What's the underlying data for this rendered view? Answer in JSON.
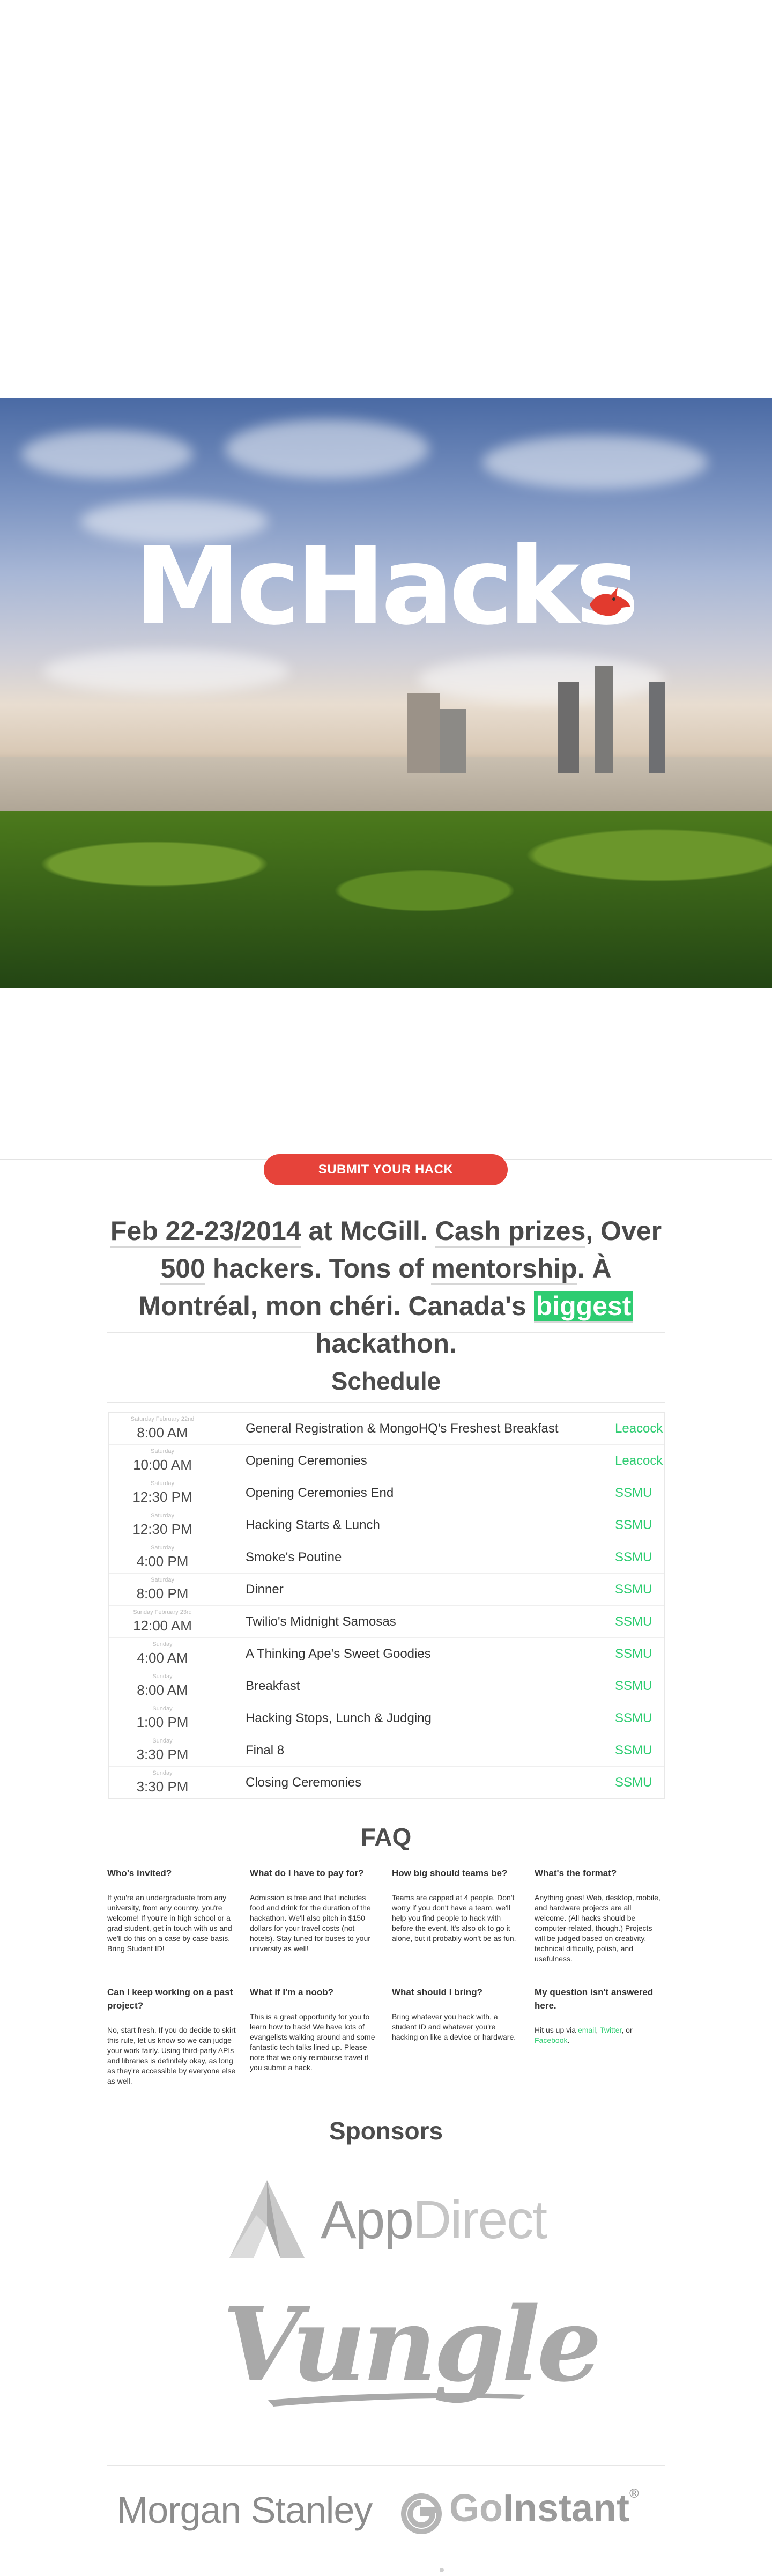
{
  "hero": {
    "logo_text": "McHacks",
    "bird": "red-cardinal-icon"
  },
  "submit_label": "SUBMIT YOUR HACK",
  "intro": {
    "date": "Feb 22-23/2014",
    "at": "at McGill.",
    "cash": "Cash prizes",
    "over": ", Over",
    "count": "500",
    "hackers": "hackers. Tons of",
    "mentorship": "mentorship",
    "montreal": ". À Montréal, mon chéri. Canada's",
    "biggest": "biggest",
    "hackathon": "hackathon."
  },
  "schedule": {
    "title": "Schedule",
    "rows": [
      {
        "day": "Saturday February 22nd",
        "time": "8:00 AM",
        "event": "General Registration & MongoHQ's Freshest Breakfast",
        "location": "Leacock"
      },
      {
        "day": "Saturday",
        "time": "10:00 AM",
        "event": "Opening Ceremonies",
        "location": "Leacock"
      },
      {
        "day": "Saturday",
        "time": "12:30 PM",
        "event": "Opening Ceremonies End",
        "location": "SSMU"
      },
      {
        "day": "Saturday",
        "time": "12:30 PM",
        "event": "Hacking Starts & Lunch",
        "location": "SSMU"
      },
      {
        "day": "Saturday",
        "time": "4:00 PM",
        "event": "Smoke's Poutine",
        "location": "SSMU"
      },
      {
        "day": "Saturday",
        "time": "8:00 PM",
        "event": "Dinner",
        "location": "SSMU"
      },
      {
        "day": "Sunday February 23rd",
        "time": "12:00 AM",
        "event": "Twilio's Midnight Samosas",
        "location": "SSMU"
      },
      {
        "day": "Sunday",
        "time": "4:00 AM",
        "event": "A Thinking Ape's Sweet Goodies",
        "location": "SSMU"
      },
      {
        "day": "Sunday",
        "time": "8:00 AM",
        "event": "Breakfast",
        "location": "SSMU"
      },
      {
        "day": "Sunday",
        "time": "1:00 PM",
        "event": "Hacking Stops, Lunch & Judging",
        "location": "SSMU"
      },
      {
        "day": "Sunday",
        "time": "3:30 PM",
        "event": "Final 8",
        "location": "SSMU"
      },
      {
        "day": "Sunday",
        "time": "3:30 PM",
        "event": "Closing Ceremonies",
        "location": "SSMU"
      }
    ]
  },
  "faq": {
    "title": "FAQ",
    "items": [
      {
        "q": "Who's invited?",
        "a": "If you're an undergraduate from any university, from any country, you're welcome! If you're in high school or a grad student, get in touch with us and we'll do this on a case by case basis. Bring Student ID!"
      },
      {
        "q": "What do I have to pay for?",
        "a": "Admission is free and that includes food and drink for the duration of the hackathon. We'll also pitch in $150 dollars for your travel costs (not hotels). Stay tuned for buses to your university as well!"
      },
      {
        "q": "How big should teams be?",
        "a": "Teams are capped at 4 people. Don't worry if you don't have a team, we'll help you find people to hack with before the event. It's also ok to go it alone, but it probably won't be as fun."
      },
      {
        "q": "What's the format?",
        "a": "Anything goes! Web, desktop, mobile, and hardware projects are all welcome. (All hacks should be computer-related, though.) Projects will be judged based on creativity, technical difficulty, polish, and usefulness."
      },
      {
        "q": "Can I keep working on a past project?",
        "a": "No, start fresh. If you do decide to skirt this rule, let us know so we can judge your work fairly. Using third-party APIs and libraries is definitely okay, as long as they're accessible by everyone else as well."
      },
      {
        "q": "What if I'm a noob?",
        "a": "This is a great opportunity for you to learn how to hack! We have lots of evangelists walking around and some fantastic tech talks lined up. Please note that we only reimburse travel if you submit a hack."
      },
      {
        "q": "What should I bring?",
        "a": "Bring whatever you hack with, a student ID and whatever you're hacking on like a device or hardware."
      },
      {
        "q": "My question isn't answered here.",
        "a_prefix": "Hit us up via ",
        "email": "email",
        "c1": ", ",
        "twitter": "Twitter",
        "c2": ", or ",
        "facebook": "Facebook",
        "end": "."
      }
    ]
  },
  "sponsors": {
    "title": "Sponsors",
    "appdirect": "AppDirect",
    "vungle": "Vungle",
    "morgan": "Morgan Stanley",
    "goinstant_go": "Go",
    "goinstant_instant": "Instant",
    "reg": "®"
  }
}
